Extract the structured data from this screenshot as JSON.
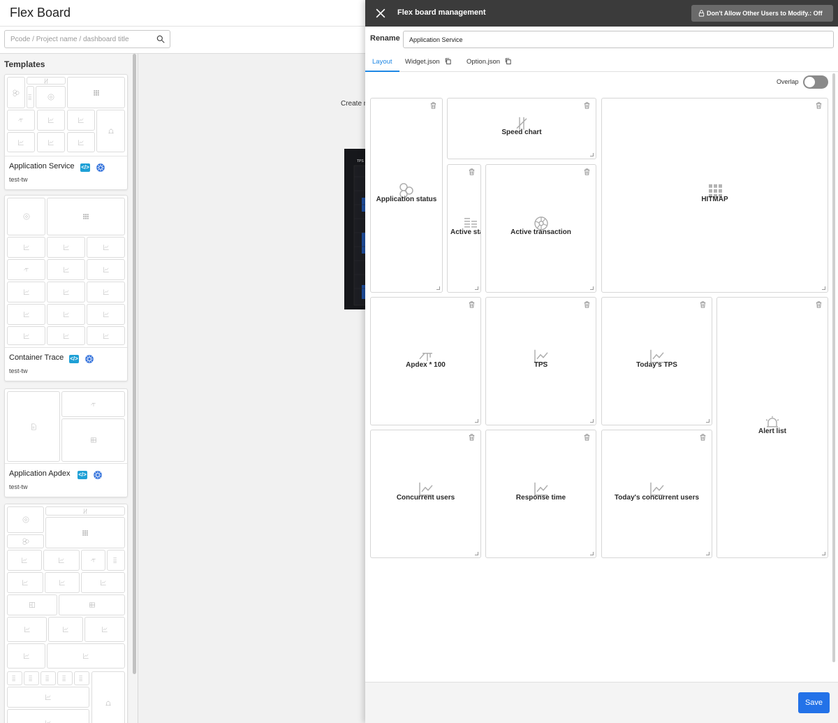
{
  "page": {
    "title": "Flex Board",
    "search_placeholder": "Pcode / Project name / dashboard title",
    "create_text": "Create n"
  },
  "templates": {
    "title": "Templates",
    "items": [
      {
        "name": "Application Service",
        "owner": "test-tw"
      },
      {
        "name": "Container Trace",
        "owner": "test-tw"
      },
      {
        "name": "Application Apdex",
        "owner": "test-tw"
      }
    ]
  },
  "drawer": {
    "title": "Flex board management",
    "lock_button": "Don't Allow Other Users to Modify.: Off",
    "rename_label": "Rename",
    "rename_value": "Application Service",
    "tabs": {
      "layout": "Layout",
      "widget_json": "Widget.json",
      "option_json": "Option.json"
    },
    "overlap_label": "Overlap",
    "overlap_on": false,
    "widgets": {
      "app_status": "Application status",
      "speed_chart": "Speed chart",
      "active_status": "Active sta",
      "active_transaction": "Active transaction",
      "hitmap": "HITMAP",
      "apdex": "Apdex * 100",
      "tps": "TPS",
      "todays_tps": "Today's TPS",
      "alert_list": "Alert list",
      "concurrent_users": "Concurrent users",
      "response_time": "Response time",
      "todays_concurrent_users": "Today's concurrent users"
    },
    "save_label": "Save"
  },
  "colors": {
    "header_dark": "#3b3b3b",
    "accent": "#1e88e5",
    "save": "#2372e8",
    "badge": "#1ea0d6"
  }
}
